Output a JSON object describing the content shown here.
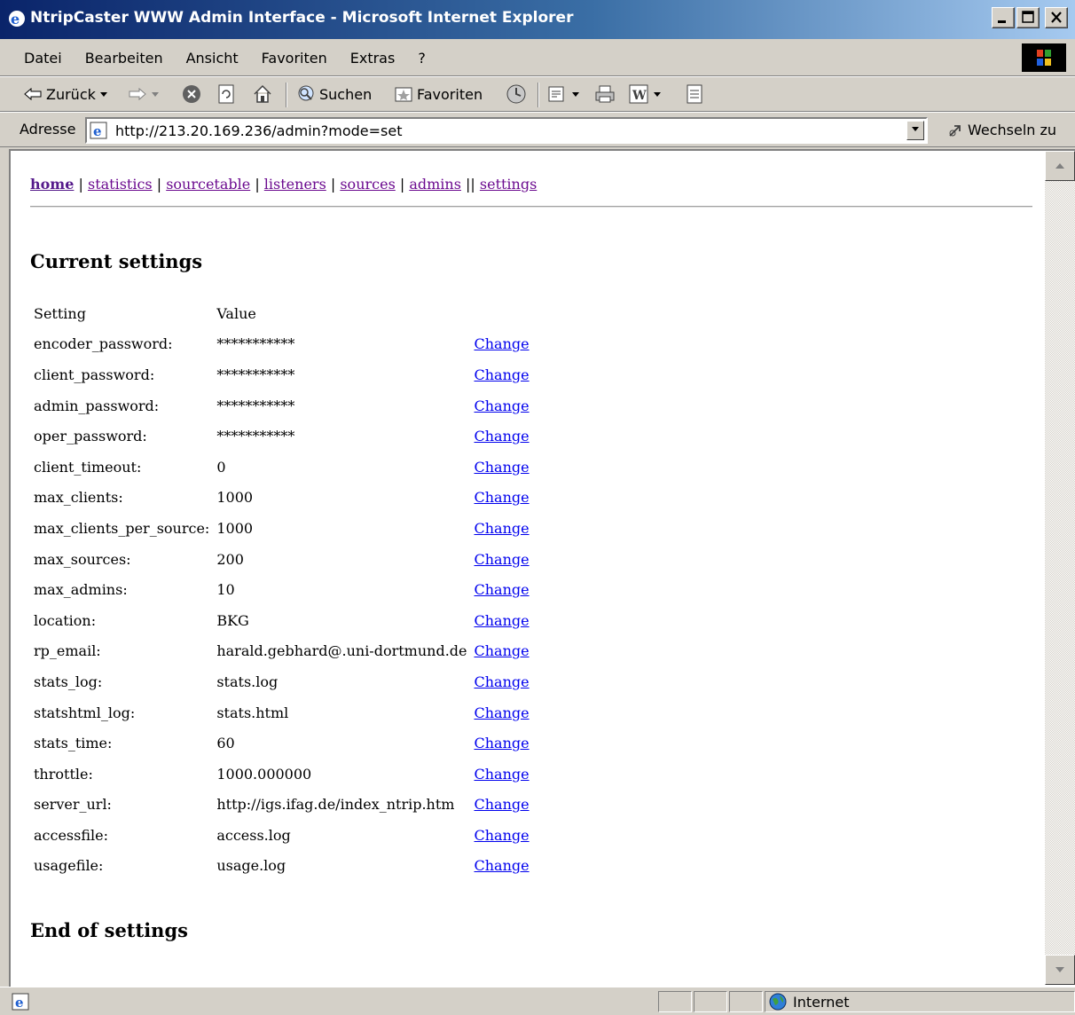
{
  "window": {
    "title": "NtripCaster WWW Admin Interface - Microsoft Internet Explorer"
  },
  "menu": [
    "Datei",
    "Bearbeiten",
    "Ansicht",
    "Favoriten",
    "Extras",
    "?"
  ],
  "toolbar": {
    "back_label": "Zurück",
    "search_label": "Suchen",
    "favorites_label": "Favoriten"
  },
  "address": {
    "label": "Adresse",
    "url": "http://213.20.169.236/admin?mode=set",
    "go_label": "Wechseln zu"
  },
  "nav": {
    "home": "home",
    "statistics": "statistics",
    "sourcetable": "sourcetable",
    "listeners": "listeners",
    "sources": "sources",
    "admins": "admins",
    "settings": "settings"
  },
  "page": {
    "heading": "Current settings",
    "footer_heading": "End of settings",
    "col_setting": "Setting",
    "col_value": "Value",
    "change_label": "Change",
    "rows": [
      {
        "setting": "encoder_password:",
        "value": "***********"
      },
      {
        "setting": "client_password:",
        "value": "***********"
      },
      {
        "setting": "admin_password:",
        "value": "***********"
      },
      {
        "setting": "oper_password:",
        "value": "***********"
      },
      {
        "setting": "client_timeout:",
        "value": "0"
      },
      {
        "setting": "max_clients:",
        "value": "1000"
      },
      {
        "setting": "max_clients_per_source:",
        "value": "1000"
      },
      {
        "setting": "max_sources:",
        "value": "200"
      },
      {
        "setting": "max_admins:",
        "value": "10"
      },
      {
        "setting": "location:",
        "value": "BKG"
      },
      {
        "setting": "rp_email:",
        "value": "harald.gebhard@.uni-dortmund.de"
      },
      {
        "setting": "stats_log:",
        "value": "stats.log"
      },
      {
        "setting": "statshtml_log:",
        "value": "stats.html"
      },
      {
        "setting": "stats_time:",
        "value": "60"
      },
      {
        "setting": "throttle:",
        "value": "1000.000000"
      },
      {
        "setting": "server_url:",
        "value": "http://igs.ifag.de/index_ntrip.htm"
      },
      {
        "setting": "accessfile:",
        "value": "access.log"
      },
      {
        "setting": "usagefile:",
        "value": "usage.log"
      }
    ]
  },
  "status": {
    "zone": "Internet"
  }
}
